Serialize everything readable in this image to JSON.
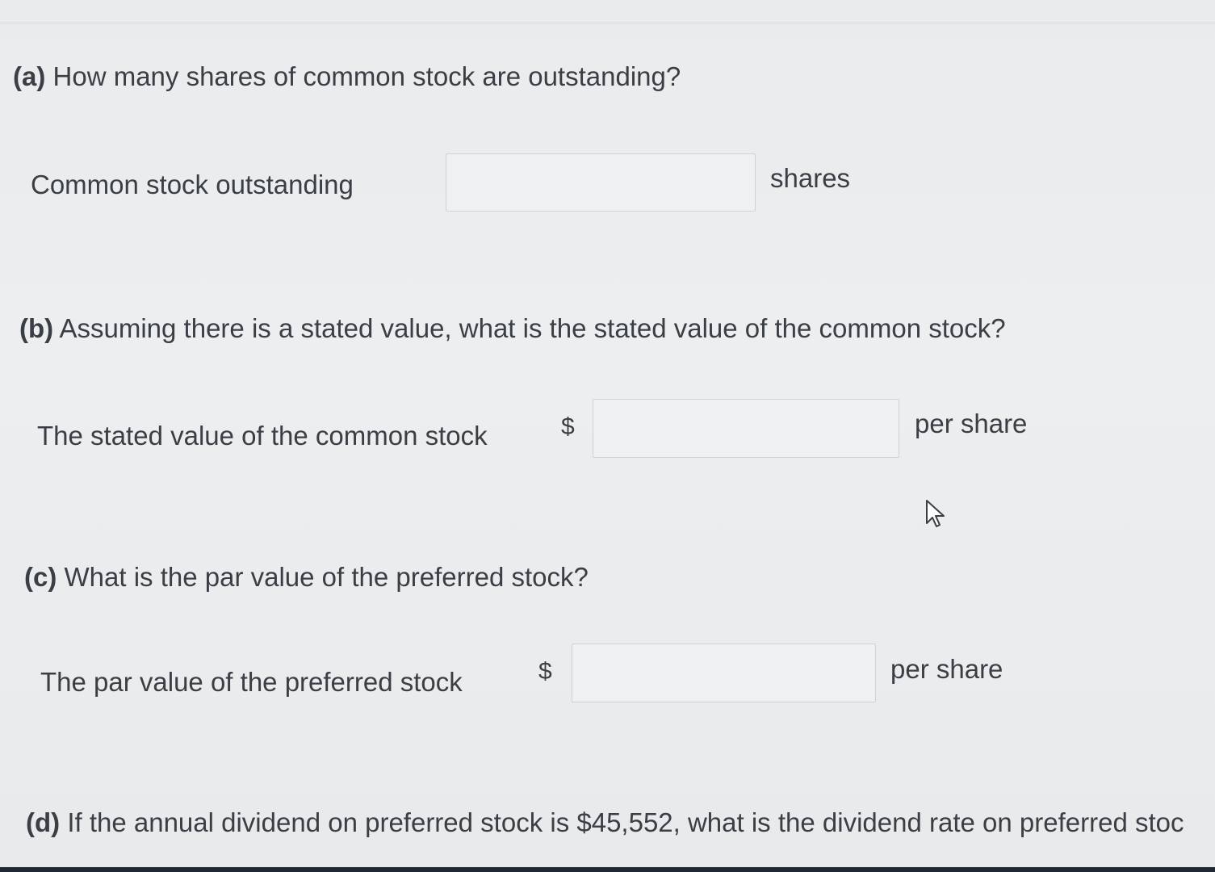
{
  "part_a": {
    "letter": "(a)",
    "question": "How many shares of common stock are outstanding?",
    "label": "Common stock outstanding",
    "value": "",
    "unit": "shares"
  },
  "part_b": {
    "letter": "(b)",
    "question": "Assuming there is a stated value, what is the stated value of the common stock?",
    "label": "The stated value of the common stock",
    "currency": "$",
    "value": "",
    "unit": "per share"
  },
  "part_c": {
    "letter": "(c)",
    "question": "What is the par value of the preferred stock?",
    "label": "The par value of the preferred stock",
    "currency": "$",
    "value": "",
    "unit": "per share"
  },
  "part_d": {
    "letter": "(d)",
    "question": "If the annual dividend on preferred stock is $45,552, what is the dividend rate on preferred stoc"
  },
  "colors": {
    "background": "#eaeced",
    "text": "#3a3f45",
    "input_border": "#cfd3d6",
    "bottom_bar": "#1f2933"
  },
  "icons": {
    "pointer": "mouse-pointer-icon"
  }
}
